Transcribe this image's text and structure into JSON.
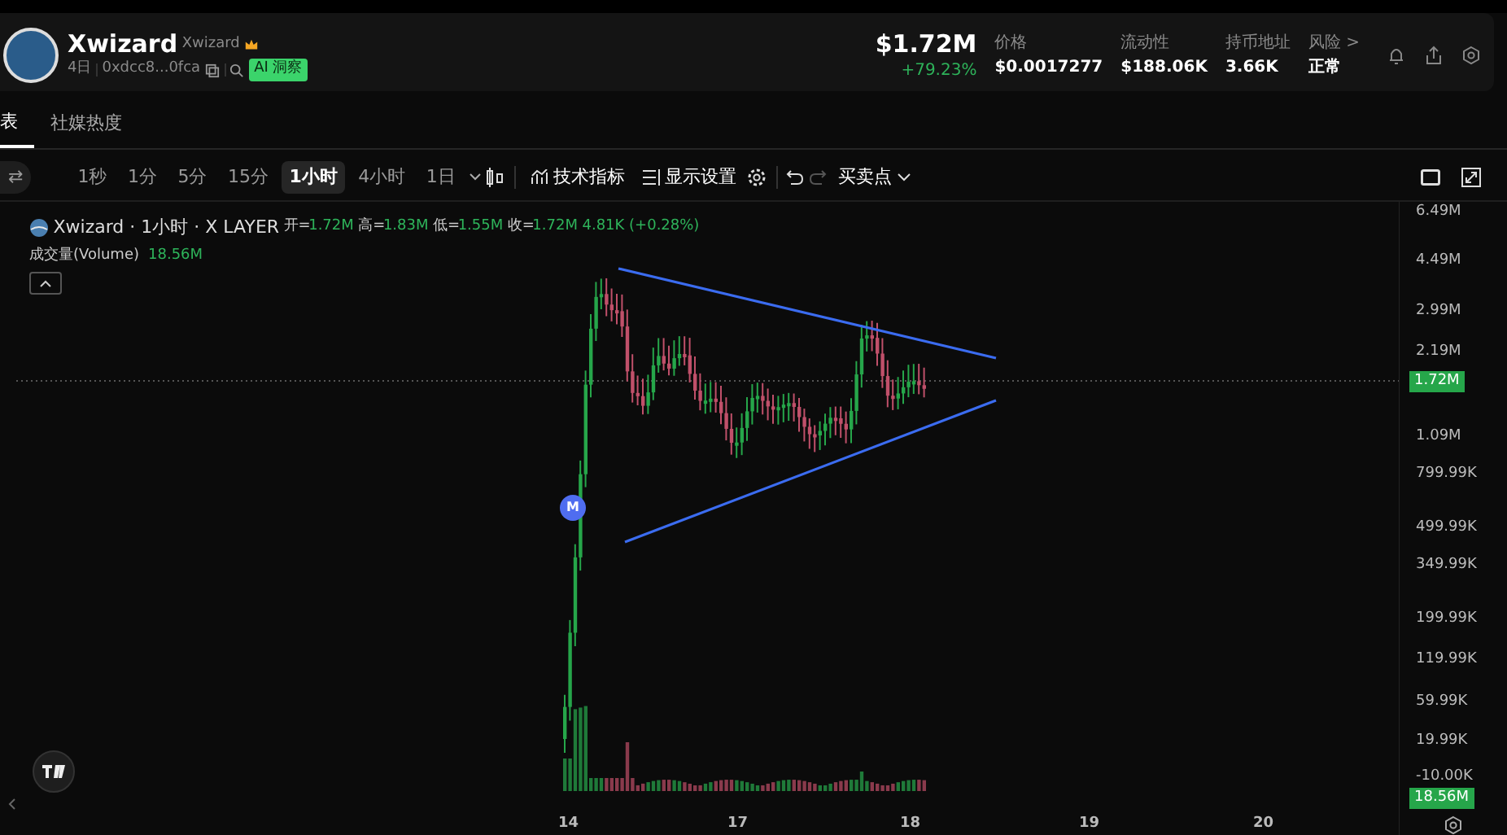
{
  "token": {
    "name": "Xwizard",
    "symbol": "Xwizard",
    "age": "4日",
    "address": "0xdcc8...0fca",
    "ai_badge": "AI 洞察",
    "market_cap": "$1.72M",
    "change": "+79.23%"
  },
  "stats": [
    {
      "label": "价格",
      "value": "$0.0017277"
    },
    {
      "label": "流动性",
      "value": "$188.06K"
    },
    {
      "label": "持币地址",
      "value": "3.66K"
    },
    {
      "label": "风险 >",
      "value": "正常"
    }
  ],
  "tabs": [
    {
      "label": "表",
      "selected": true
    },
    {
      "label": "社媒热度",
      "selected": false
    }
  ],
  "toolbar": {
    "lead": "⇄",
    "intervals": [
      {
        "label": "1秒",
        "selected": false
      },
      {
        "label": "1分",
        "selected": false
      },
      {
        "label": "5分",
        "selected": false
      },
      {
        "label": "15分",
        "selected": false
      },
      {
        "label": "1小时",
        "selected": true
      },
      {
        "label": "4小时",
        "selected": false
      },
      {
        "label": "1日",
        "selected": false
      }
    ],
    "indicators": "技术指标",
    "display": "显示设置",
    "trade_points": "买卖点"
  },
  "chart": {
    "title": "Xwizard · 1小时 · X LAYER",
    "ohlc": [
      {
        "label": "开=",
        "value": "1.72M"
      },
      {
        "label": "高=",
        "value": "1.83M"
      },
      {
        "label": "低=",
        "value": "1.55M"
      },
      {
        "label": "收=",
        "value": "1.72M"
      }
    ],
    "change": "4.81K (+0.28%)",
    "volume_label": "成交量(Volume)",
    "volume_value": "18.56M",
    "marker": "M",
    "price_axis": [
      "6.49M",
      "4.49M",
      "2.99M",
      "2.19M",
      "1.09M",
      "799.99K",
      "499.99K",
      "349.99K",
      "199.99K",
      "119.99K",
      "59.99K",
      "19.99K",
      "-10.00K"
    ],
    "price_tag": "1.72M",
    "volume_tag": "18.56M",
    "time_axis": [
      "14",
      "17",
      "18",
      "19",
      "20"
    ]
  }
}
